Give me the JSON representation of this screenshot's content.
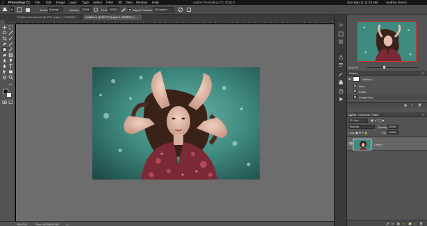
{
  "menubar": {
    "app": "Photoshop CC",
    "items": [
      "File",
      "Edit",
      "Image",
      "Layer",
      "Type",
      "Select",
      "Filter",
      "3D",
      "View",
      "Window",
      "Help"
    ],
    "window_title": "Adobe Photoshop CC 2015.0",
    "clock": "Sun Sep 11 11:23 AM",
    "user": "Andrew Geron"
  },
  "options": {
    "mode_label": "Mode:",
    "mode_value": "Normal",
    "opacity_label": "Opacity:",
    "opacity_value": "100%",
    "flow_label": "Flow:",
    "flow_value": "100%",
    "aligned_label": "Aligned",
    "sample_label": "Sample:",
    "sample_value": "All Layers"
  },
  "tabs": [
    {
      "label": "5-Water-woman.psd @ 25% (Layer 1, RGB/8*) ×",
      "active": false
    },
    {
      "label": "Untitled-1 @ 56.7% (Layer 1, RGB/8*) ×",
      "active": true
    }
  ],
  "status": {
    "zoom": "56.67%",
    "doc": "Doc: 46.0M/46.0M"
  },
  "history": {
    "title": "History",
    "snapshot": "Untitled-1",
    "steps": [
      "New",
      "Paste",
      "Image Size"
    ]
  },
  "layers": {
    "tabs": [
      "Layers",
      "Channels",
      "Paths"
    ],
    "kind_label": "Kind",
    "blend_mode": "Normal",
    "opacity_label": "Opacity:",
    "opacity_value": "100%",
    "lock_label": "Lock:",
    "fill_label": "Fill:",
    "fill_value": "100%",
    "layer_name": "Layer 1"
  },
  "colors": {
    "accent": "#1d8cf0",
    "canvas_bg": "#6d6d6d",
    "panel_bg": "#535353"
  }
}
